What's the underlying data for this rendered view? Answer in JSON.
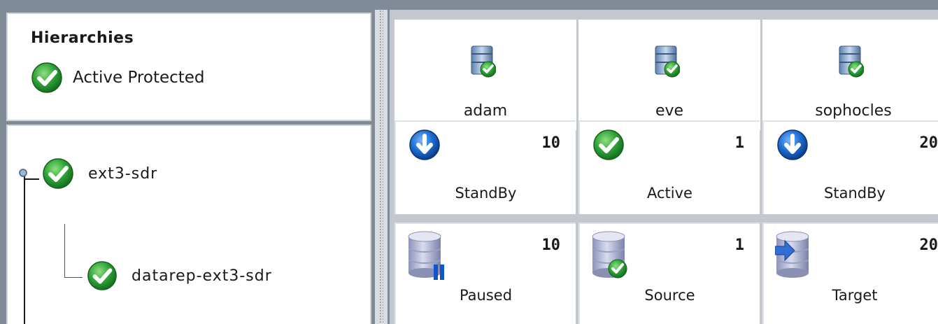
{
  "hierarchies": {
    "title": "Hierarchies",
    "status_label": "Active Protected"
  },
  "tree": {
    "root": {
      "label": "ext3-sdr",
      "icon": "check-circle-icon"
    },
    "child": {
      "label": "datarep-ext3-sdr",
      "icon": "check-circle-icon"
    }
  },
  "servers": [
    {
      "name": "adam",
      "icon": "server-ok-icon"
    },
    {
      "name": "eve",
      "icon": "server-ok-icon"
    },
    {
      "name": "sophocles",
      "icon": "server-ok-icon"
    }
  ],
  "state_row": [
    {
      "priority": "10",
      "state": "StandBy",
      "icon": "standby-arrow-icon"
    },
    {
      "priority": "1",
      "state": "Active",
      "icon": "check-circle-icon"
    },
    {
      "priority": "20",
      "state": "StandBy",
      "icon": "standby-arrow-icon"
    }
  ],
  "mirror_row": [
    {
      "priority": "10",
      "state": "Paused",
      "icon": "disk-paused-icon"
    },
    {
      "priority": "1",
      "state": "Source",
      "icon": "disk-source-icon"
    },
    {
      "priority": "20",
      "state": "Target",
      "icon": "disk-target-icon"
    }
  ],
  "colors": {
    "ok_green": "#2fa43a",
    "standby_blue": "#1f6fd1",
    "window_bg": "#7f8b99",
    "panel_border": "#cfd3d8"
  }
}
